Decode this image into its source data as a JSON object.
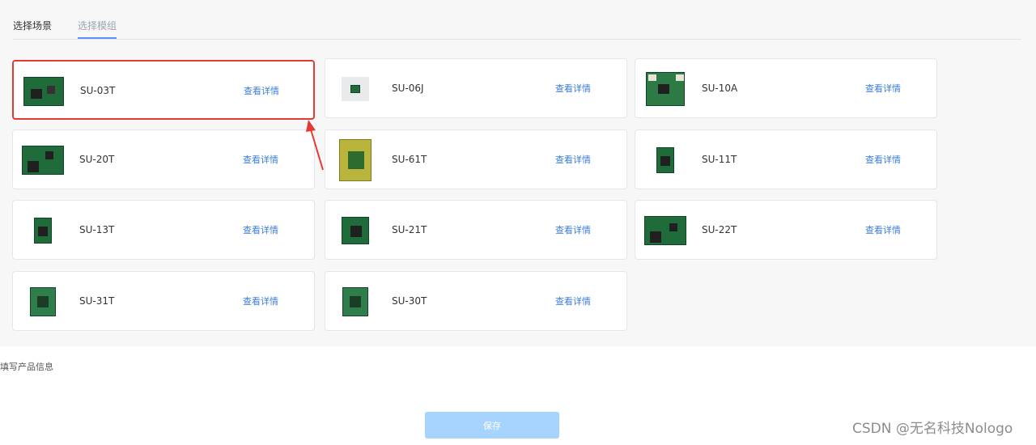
{
  "tabs": [
    {
      "label": "选择场景"
    },
    {
      "label": "选择模组"
    }
  ],
  "modules": [
    {
      "name": "SU-03T",
      "detail_label": "查看详情",
      "selected": true
    },
    {
      "name": "SU-06J",
      "detail_label": "查看详情"
    },
    {
      "name": "SU-10A",
      "detail_label": "查看详情"
    },
    {
      "name": "SU-20T",
      "detail_label": "查看详情"
    },
    {
      "name": "SU-61T",
      "detail_label": "查看详情"
    },
    {
      "name": "SU-11T",
      "detail_label": "查看详情"
    },
    {
      "name": "SU-13T",
      "detail_label": "查看详情"
    },
    {
      "name": "SU-21T",
      "detail_label": "查看详情"
    },
    {
      "name": "SU-22T",
      "detail_label": "查看详情"
    },
    {
      "name": "SU-31T",
      "detail_label": "查看详情"
    },
    {
      "name": "SU-30T",
      "detail_label": "查看详情"
    }
  ],
  "section_label": "填写产品信息",
  "save_label": "保存",
  "watermark": "CSDN @无名科技Nologo",
  "colors": {
    "accent_link": "#3b7ddd",
    "selection_highlight": "#e53935",
    "save_button": "#a7d3ff",
    "pcb_green": "#1f6b3a"
  }
}
